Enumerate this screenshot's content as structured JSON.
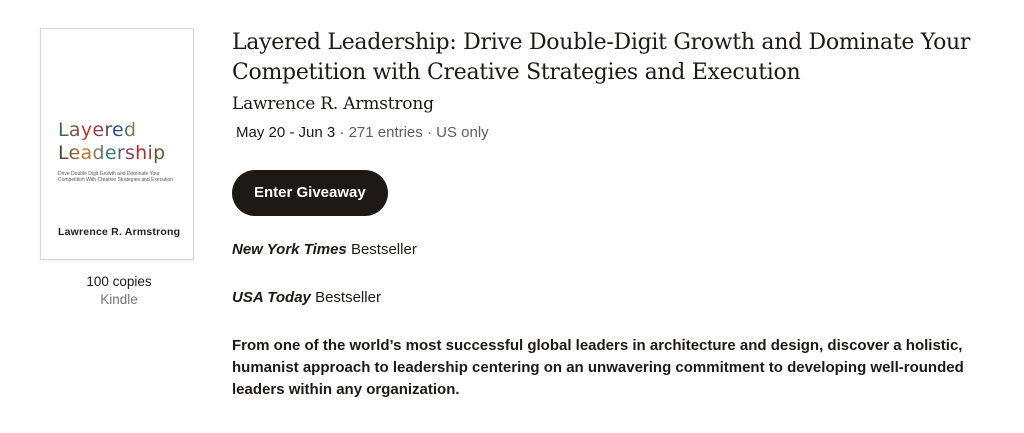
{
  "cover": {
    "title_line1": "Layered",
    "title_line2": "Leadership",
    "subtitle": "Drive Double Digit Growth and Dominate Your Competition With Creative Strategies and Execution",
    "author": "Lawrence R. Armstrong"
  },
  "giveaway": {
    "copies": "100 copies",
    "format": "Kindle",
    "title": "Layered Leadership: Drive Double-Digit Growth and Dominate Your Competition with Creative Strategies and Execution",
    "author": "Lawrence R. Armstrong",
    "dates": "May 20 - Jun 3",
    "separator1": " · ",
    "entries": "271 entries",
    "separator2": " · ",
    "region": "US only",
    "enter_button": "Enter Giveaway"
  },
  "description": {
    "p1_italic": "New York Times",
    "p1_rest": " Bestseller",
    "p2_italic": "USA Today",
    "p2_rest": " Bestseller",
    "p3": "From one of the world’s most successful global leaders in architecture and design, discover a holistic, humanist approach to leadership centering on an unwavering commitment to developing well-rounded leaders within any organization."
  }
}
